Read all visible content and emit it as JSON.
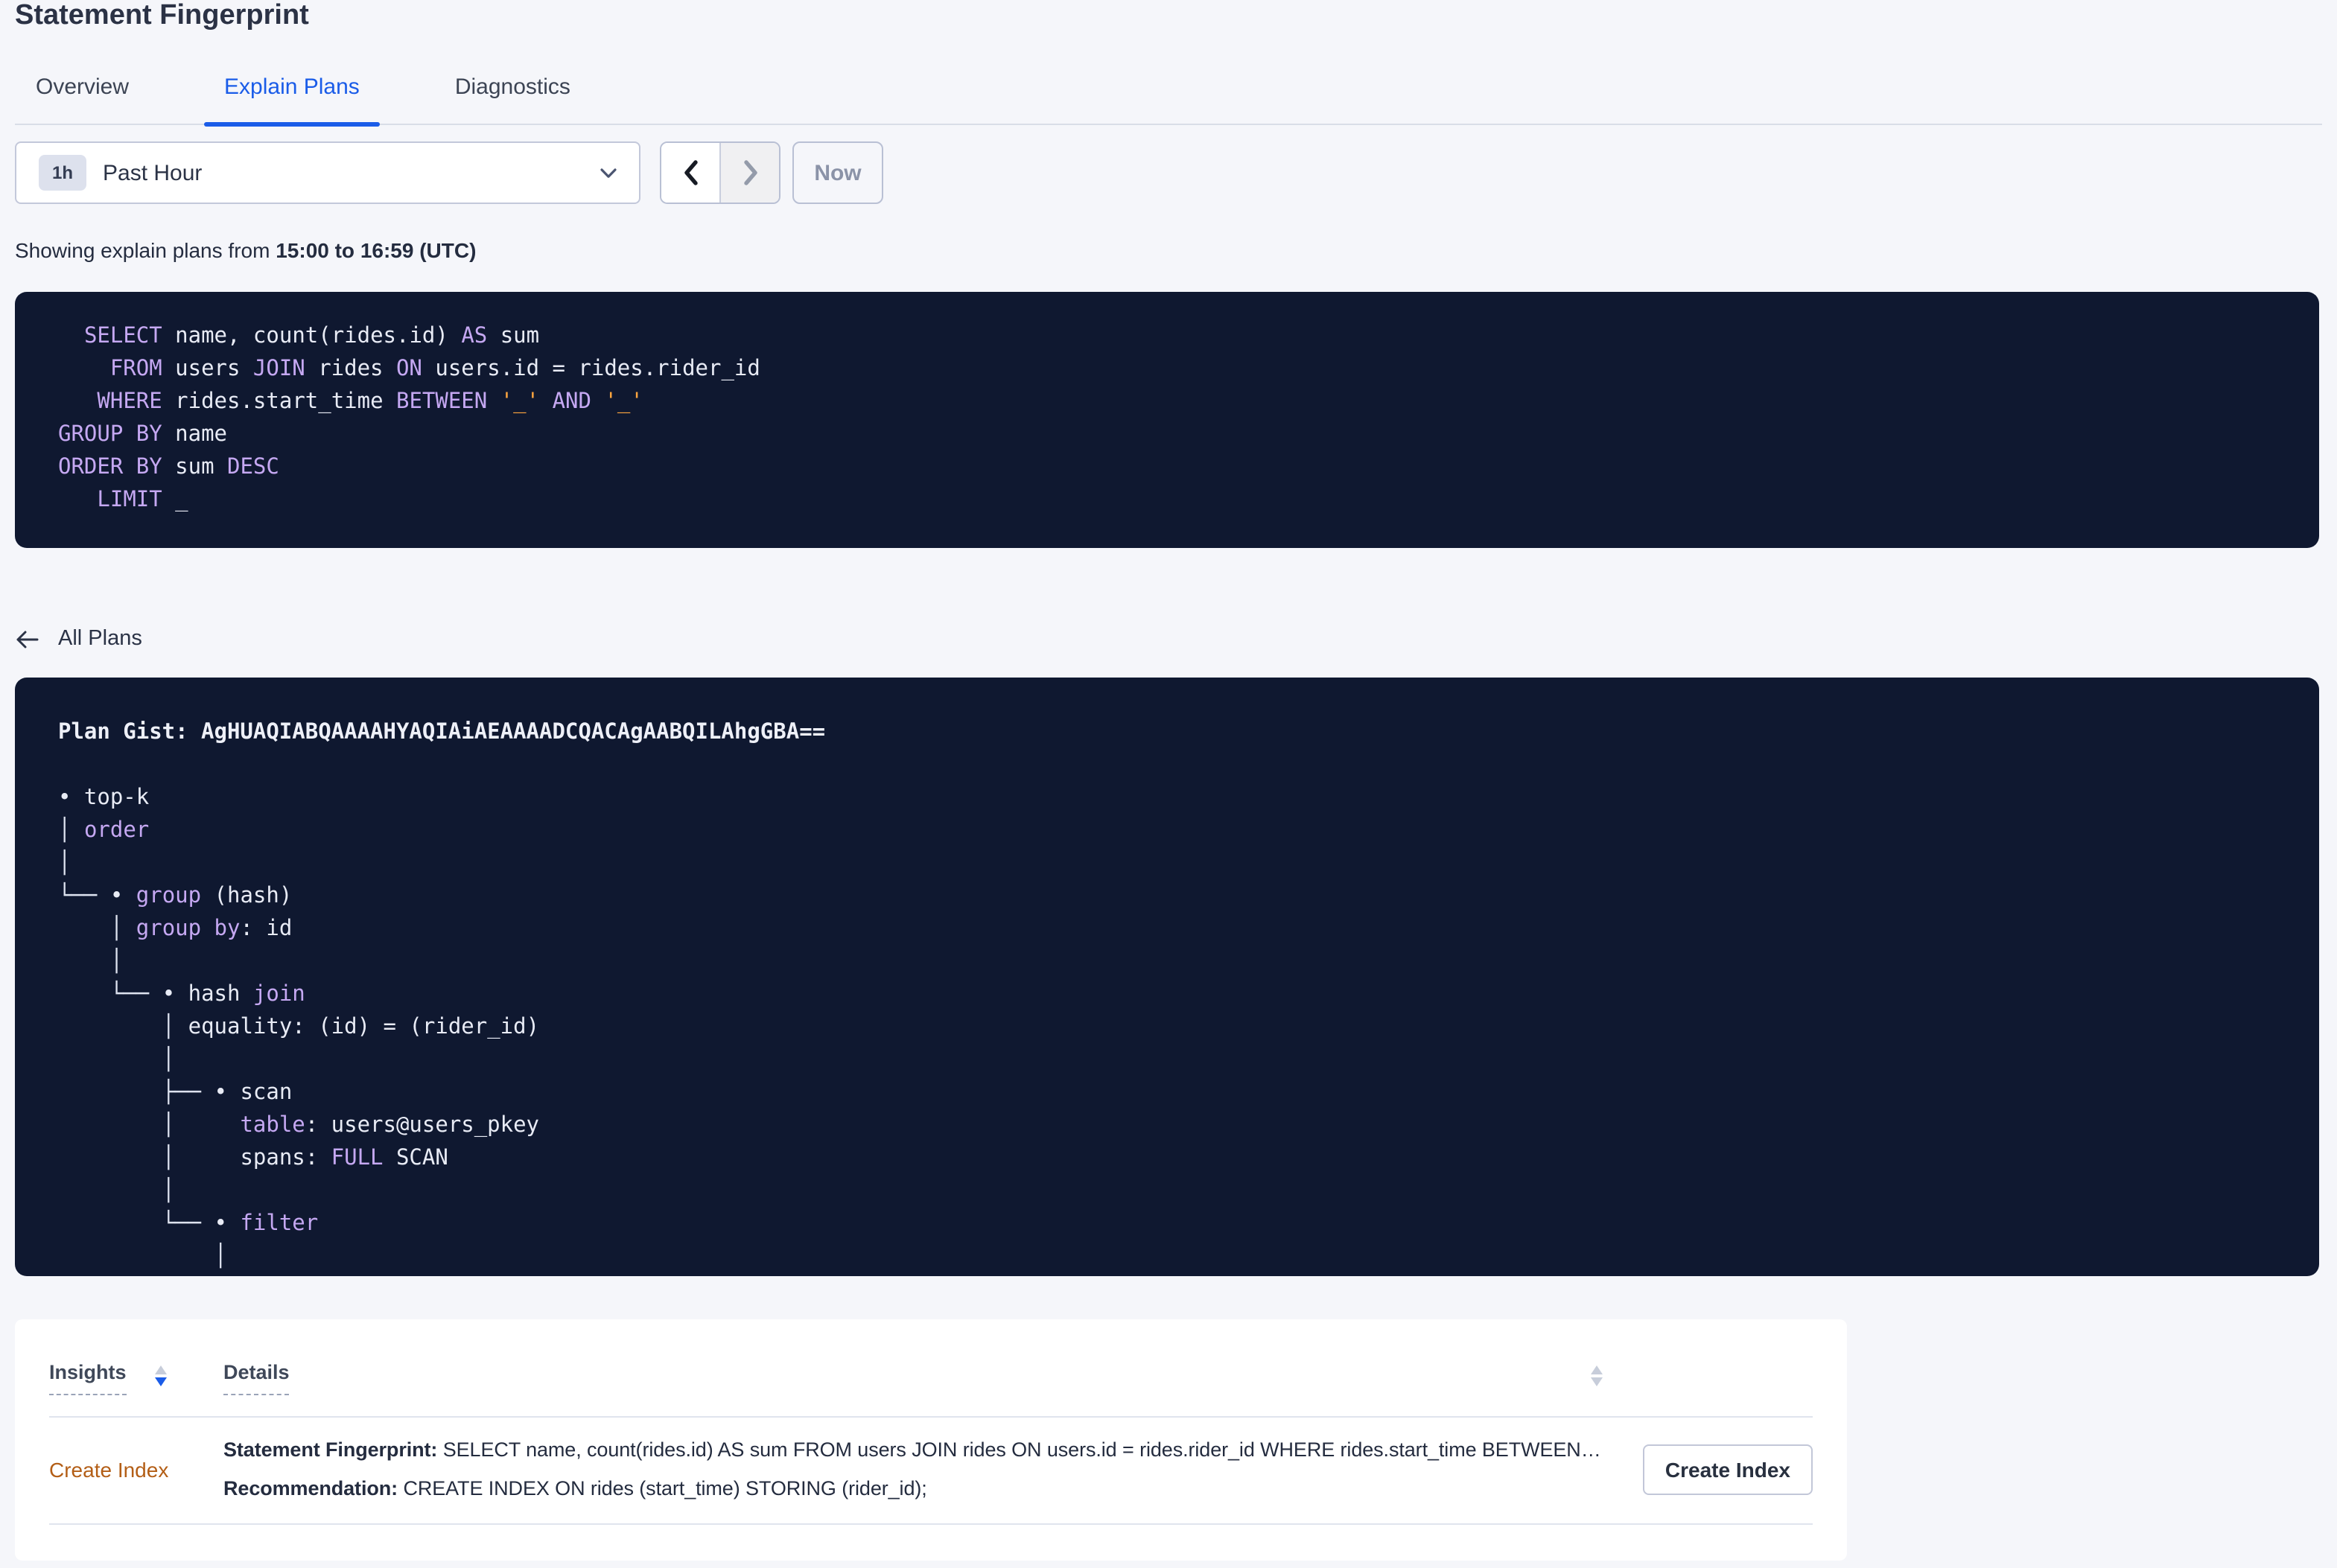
{
  "colors": {
    "accent_blue": "#1a5ce8",
    "panel_background": "#0f1830",
    "keyword_purple": "#c5a8f2",
    "literal_orange": "#ffa63f",
    "code_text": "#e8ebf5",
    "insight_link_orange": "#b35e16",
    "page_background": "#f5f6fa"
  },
  "header": {
    "title": "Statement Fingerprint",
    "tabs": [
      {
        "label": "Overview",
        "active": false
      },
      {
        "label": "Explain Plans",
        "active": true
      },
      {
        "label": "Diagnostics",
        "active": false
      }
    ]
  },
  "time_controls": {
    "interval_badge": "1h",
    "interval_label": "Past Hour",
    "now_label": "Now"
  },
  "caption": {
    "prefix": "Showing explain plans from",
    "range": "15:00 to 16:59 (UTC)"
  },
  "sql_statement": {
    "lines": [
      [
        [
          "t",
          "  "
        ],
        [
          "k",
          "SELECT"
        ],
        [
          "t",
          " name, count(rides.id) "
        ],
        [
          "k",
          "AS"
        ],
        [
          "t",
          " sum"
        ]
      ],
      [
        [
          "t",
          "    "
        ],
        [
          "k",
          "FROM"
        ],
        [
          "t",
          " users "
        ],
        [
          "k",
          "JOIN"
        ],
        [
          "t",
          " rides "
        ],
        [
          "k",
          "ON"
        ],
        [
          "t",
          " users.id = rides.rider_id"
        ]
      ],
      [
        [
          "t",
          "   "
        ],
        [
          "k",
          "WHERE"
        ],
        [
          "t",
          " rides.start_time "
        ],
        [
          "k",
          "BETWEEN"
        ],
        [
          "t",
          " "
        ],
        [
          "l",
          "'_'"
        ],
        [
          "t",
          " "
        ],
        [
          "k",
          "AND"
        ],
        [
          "t",
          " "
        ],
        [
          "l",
          "'_'"
        ]
      ],
      [
        [
          "k",
          "GROUP BY"
        ],
        [
          "t",
          " name"
        ]
      ],
      [
        [
          "k",
          "ORDER BY"
        ],
        [
          "t",
          " sum "
        ],
        [
          "k",
          "DESC"
        ]
      ],
      [
        [
          "t",
          "   "
        ],
        [
          "k",
          "LIMIT"
        ],
        [
          "t",
          " _"
        ]
      ]
    ]
  },
  "plans_nav": {
    "back_label": "All Plans"
  },
  "plan_view": {
    "lines": [
      [
        [
          "b",
          "Plan Gist: AgHUAQIABQAAAAHYAQIAiAEAAAADCQACAgAABQILAhgGBA=="
        ]
      ],
      [],
      [
        [
          "t",
          "• top-k"
        ]
      ],
      [
        [
          "d",
          "│ "
        ],
        [
          "k",
          "order"
        ]
      ],
      [
        [
          "d",
          "│"
        ]
      ],
      [
        [
          "d",
          "└── "
        ],
        [
          "t",
          "• "
        ],
        [
          "k",
          "group"
        ],
        [
          "t",
          " (hash)"
        ]
      ],
      [
        [
          "d",
          "    │ "
        ],
        [
          "k",
          "group by"
        ],
        [
          "t",
          ": id"
        ]
      ],
      [
        [
          "d",
          "    │"
        ]
      ],
      [
        [
          "d",
          "    └── "
        ],
        [
          "t",
          "• hash "
        ],
        [
          "k",
          "join"
        ]
      ],
      [
        [
          "d",
          "        │ "
        ],
        [
          "t",
          "equality: (id) = (rider_id)"
        ]
      ],
      [
        [
          "d",
          "        │"
        ]
      ],
      [
        [
          "d",
          "        ├── "
        ],
        [
          "t",
          "• scan"
        ]
      ],
      [
        [
          "d",
          "        │     "
        ],
        [
          "k",
          "table"
        ],
        [
          "t",
          ": users@users_pkey"
        ]
      ],
      [
        [
          "d",
          "        │     "
        ],
        [
          "t",
          "spans: "
        ],
        [
          "k",
          "FULL"
        ],
        [
          "t",
          " SCAN"
        ]
      ],
      [
        [
          "d",
          "        │"
        ]
      ],
      [
        [
          "d",
          "        └── "
        ],
        [
          "t",
          "• "
        ],
        [
          "k",
          "filter"
        ]
      ],
      [
        [
          "d",
          "            │"
        ]
      ]
    ]
  },
  "insights_table": {
    "columns": [
      {
        "label": "Insights",
        "sort": "desc"
      },
      {
        "label": "Details",
        "sort": "none"
      }
    ],
    "rows": [
      {
        "insight": "Create Index",
        "statement_label": "Statement Fingerprint:",
        "statement": "SELECT name, count(rides.id) AS sum FROM users JOIN rides ON users.id = rides.rider_id WHERE rides.start_time BETWEEN '_…",
        "recommendation_label": "Recommendation:",
        "recommendation": "CREATE INDEX ON rides (start_time) STORING (rider_id);",
        "action_label": "Create Index"
      }
    ]
  }
}
